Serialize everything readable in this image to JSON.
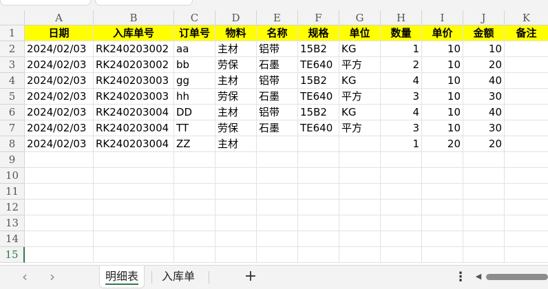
{
  "columns": [
    "A",
    "B",
    "C",
    "D",
    "E",
    "F",
    "G",
    "H",
    "I",
    "J",
    "K"
  ],
  "rows": [
    "1",
    "2",
    "3",
    "4",
    "5",
    "6",
    "7",
    "8",
    "9",
    "10",
    "11",
    "12",
    "13",
    "14",
    "15"
  ],
  "header_row": [
    "日期",
    "入库单号",
    "订单号",
    "物料",
    "名称",
    "规格",
    "单位",
    "数量",
    "单价",
    "金额",
    "备注"
  ],
  "data_rows": [
    [
      "2024/02/03",
      "RK240203002",
      "aa",
      "主材",
      "铝带",
      "15B2",
      "KG",
      "1",
      "10",
      "10",
      ""
    ],
    [
      "2024/02/03",
      "RK240203002",
      "bb",
      "劳保",
      "石墨",
      "TE640",
      "平方",
      "2",
      "10",
      "20",
      ""
    ],
    [
      "2024/02/03",
      "RK240203003",
      "gg",
      "主材",
      "铝带",
      "15B2",
      "KG",
      "4",
      "10",
      "40",
      ""
    ],
    [
      "2024/02/03",
      "RK240203003",
      "hh",
      "劳保",
      "石墨",
      "TE640",
      "平方",
      "3",
      "10",
      "30",
      ""
    ],
    [
      "2024/02/03",
      "RK240203004",
      "DD",
      "主材",
      "铝带",
      "15B2",
      "KG",
      "4",
      "10",
      "40",
      ""
    ],
    [
      "2024/02/03",
      "RK240203004",
      "TT",
      "劳保",
      "石墨",
      "TE640",
      "平方",
      "3",
      "10",
      "30",
      ""
    ],
    [
      "2024/02/03",
      "RK240203004",
      "ZZ",
      "主材",
      "",
      "",
      "",
      "1",
      "20",
      "20",
      ""
    ]
  ],
  "active_row": "15",
  "sheet_tabs": [
    {
      "label": "明细表",
      "active": true
    },
    {
      "label": "入库单",
      "active": false
    }
  ],
  "icons": {
    "prev_sheet": "‹",
    "next_sheet": "›",
    "add_sheet": "+",
    "more": "⋮",
    "scroll_left": "◀"
  },
  "colors": {
    "header_fill": "#ffff00",
    "accent": "#2d7a4b"
  }
}
